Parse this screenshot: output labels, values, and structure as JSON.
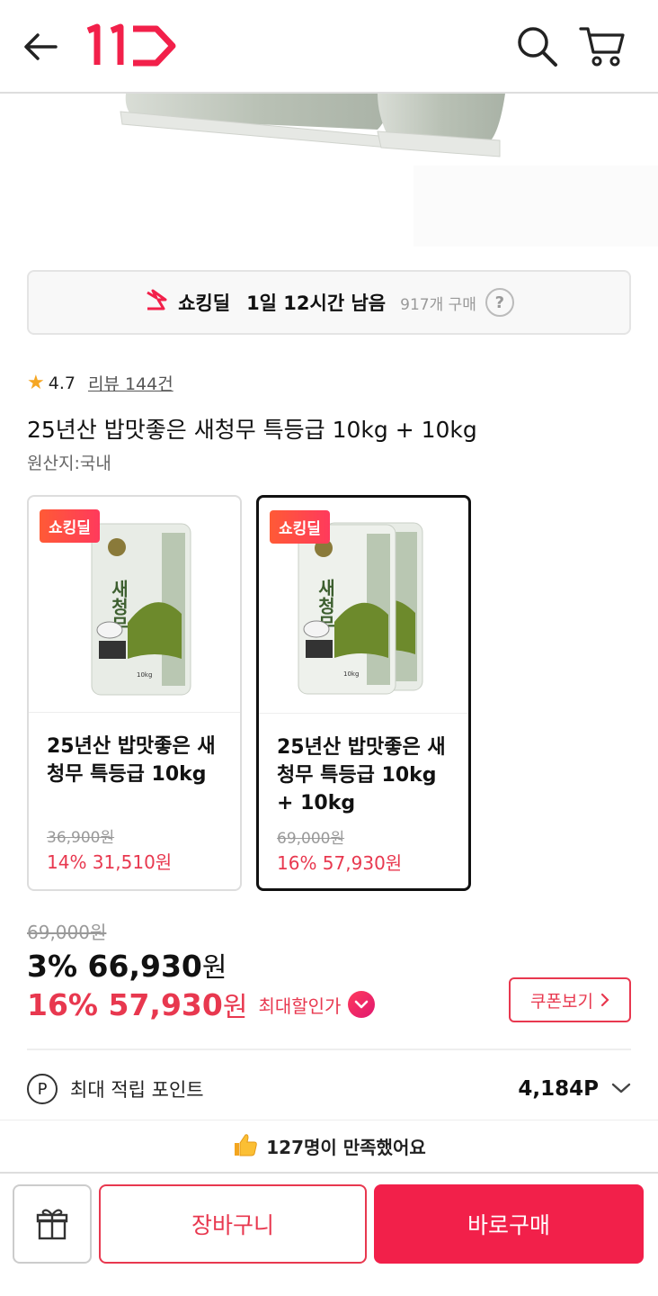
{
  "header": {
    "logo_text": "11",
    "brand_color": "#f2204a"
  },
  "deal": {
    "label": "쇼킹딜",
    "time_left": "1일 12시간 남음",
    "purchase_count": "917개 구매",
    "help": "?"
  },
  "rating": {
    "value": "4.7",
    "reviews": "리뷰 144건"
  },
  "product": {
    "title": "25년산 밥맛좋은 새청무 특등급 10kg + 10kg",
    "origin": "원산지:국내"
  },
  "options": [
    {
      "badge": "쇼킹딜",
      "name": "25년산 밥맛좋은 새청무 특등급 10kg",
      "original_price": "36,900원",
      "sale_price": "14% 31,510원",
      "bags": 1,
      "selected": false
    },
    {
      "badge": "쇼킹딜",
      "name": "25년산 밥맛좋은 새청무 특등급 10kg + 10kg",
      "original_price": "69,000원",
      "sale_price": "16% 57,930원",
      "bags": 2,
      "selected": true
    }
  ],
  "package": {
    "brand": "새청무",
    "weight": "10kg"
  },
  "price": {
    "original": "69,000원",
    "discount_pct": "3%",
    "discount_amount": "66,930",
    "max_pct": "16%",
    "max_amount": "57,930",
    "unit": "원",
    "max_label": "최대할인가",
    "coupon_label": "쿠폰보기"
  },
  "points": {
    "icon_letter": "P",
    "label": "최대 적립 포인트",
    "value": "4,184P"
  },
  "satisfaction": {
    "text": "127명이 만족했어요"
  },
  "bottom": {
    "cart_label": "장바구니",
    "buy_label": "바로구매"
  }
}
